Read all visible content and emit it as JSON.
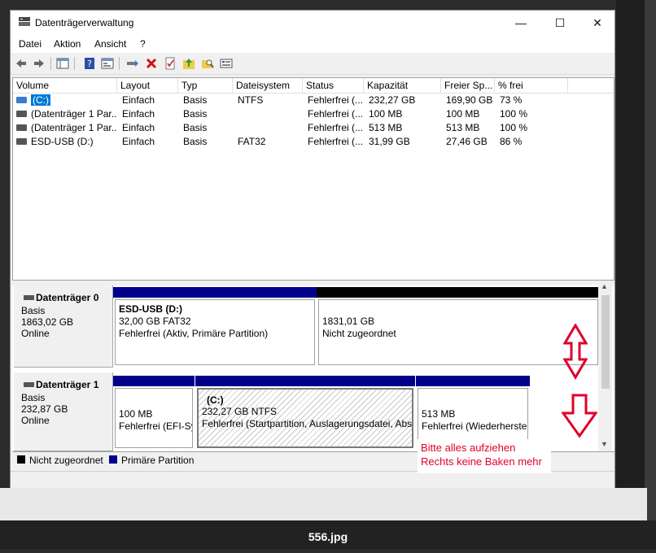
{
  "window": {
    "title": "Datenträgerverwaltung",
    "controls": {
      "minimize": "—",
      "maximize": "☐",
      "close": "✕"
    }
  },
  "menu": [
    "Datei",
    "Aktion",
    "Ansicht",
    "?"
  ],
  "toolbar_icons": [
    "back-arrow-icon",
    "forward-arrow-icon",
    "console-tree-icon",
    "help-icon",
    "properties-view-icon",
    "connect-icon",
    "delete-icon",
    "checkmark-doc-icon",
    "folder-up-icon",
    "search-folder-icon",
    "properties-icon"
  ],
  "volumes": {
    "columns": [
      "Volume",
      "Layout",
      "Typ",
      "Dateisystem",
      "Status",
      "Kapazität",
      "Freier Sp...",
      "% frei"
    ],
    "rows": [
      [
        "(C:)",
        "Einfach",
        "Basis",
        "NTFS",
        "Fehlerfrei (...",
        "232,27 GB",
        "169,90 GB",
        "73 %"
      ],
      [
        "(Datenträger 1 Par...",
        "Einfach",
        "Basis",
        "",
        "Fehlerfrei (...",
        "100 MB",
        "100 MB",
        "100 %"
      ],
      [
        "(Datenträger 1 Par...",
        "Einfach",
        "Basis",
        "",
        "Fehlerfrei (...",
        "513 MB",
        "513 MB",
        "100 %"
      ],
      [
        "ESD-USB (D:)",
        "Einfach",
        "Basis",
        "FAT32",
        "Fehlerfrei (...",
        "31,99 GB",
        "27,46 GB",
        "86 %"
      ]
    ]
  },
  "disks": [
    {
      "title": "Datenträger 0",
      "type": "Basis",
      "size": "1863,02 GB",
      "state": "Online",
      "partitions": [
        {
          "name": "ESD-USB  (D:)",
          "size": "32,00 GB FAT32",
          "status": "Fehlerfrei (Aktiv, Primäre Partition)"
        },
        {
          "name": "",
          "size": "1831,01 GB",
          "status": "Nicht zugeordnet"
        }
      ]
    },
    {
      "title": "Datenträger 1",
      "type": "Basis",
      "size": "232,87 GB",
      "state": "Online",
      "partitions": [
        {
          "name": "",
          "size": "100 MB",
          "status": "Fehlerfrei (EFI-Sy"
        },
        {
          "name": "(C:)",
          "size": "232,27 GB NTFS",
          "status": "Fehlerfrei (Startpartition, Auslagerungsdatei, Abst"
        },
        {
          "name": "",
          "size": "513 MB",
          "status": "Fehlerfrei (Wiederherste"
        }
      ]
    }
  ],
  "legend": [
    {
      "label": "Nicht zugeordnet",
      "color": "#000000"
    },
    {
      "label": "Primäre Partition",
      "color": "#00008b"
    }
  ],
  "annotation": {
    "line1": "Bitte alles aufziehen",
    "line2": "Rechts keine Baken mehr",
    "color": "#e0002a"
  },
  "footer": {
    "filename": "556.jpg"
  }
}
